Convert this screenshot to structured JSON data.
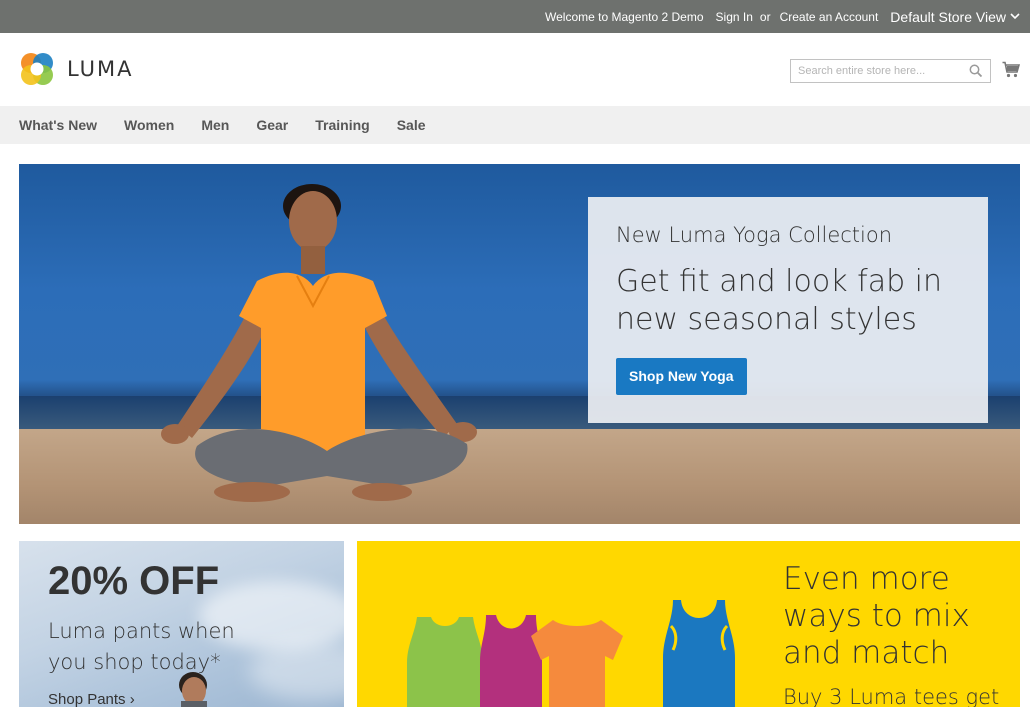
{
  "topbar": {
    "welcome": "Welcome to Magento 2 Demo",
    "sign_in": "Sign In",
    "or": "or",
    "create_account": "Create an Account",
    "store_view": "Default Store View"
  },
  "header": {
    "logo_text": "LUMA",
    "search_placeholder": "Search entire store here...",
    "icons": [
      "search-icon",
      "cart-icon"
    ]
  },
  "nav": {
    "items": [
      "What's New",
      "Women",
      "Men",
      "Gear",
      "Training",
      "Sale"
    ]
  },
  "hero": {
    "kicker": "New Luma Yoga Collection",
    "headline": "Get fit and look fab in new seasonal styles",
    "button": "Shop New Yoga"
  },
  "promo_pants": {
    "title": "20% OFF",
    "text": "Luma pants when you shop today*",
    "link": "Shop Pants ›"
  },
  "promo_tees": {
    "headline": "Even more ways to mix and match",
    "sub": "Buy 3 Luma tees get"
  },
  "colors": {
    "topbar": "#6e716e",
    "nav_bg": "#f0f0f0",
    "primary_button": "#1979c3",
    "tees_bg": "#ffd800"
  }
}
